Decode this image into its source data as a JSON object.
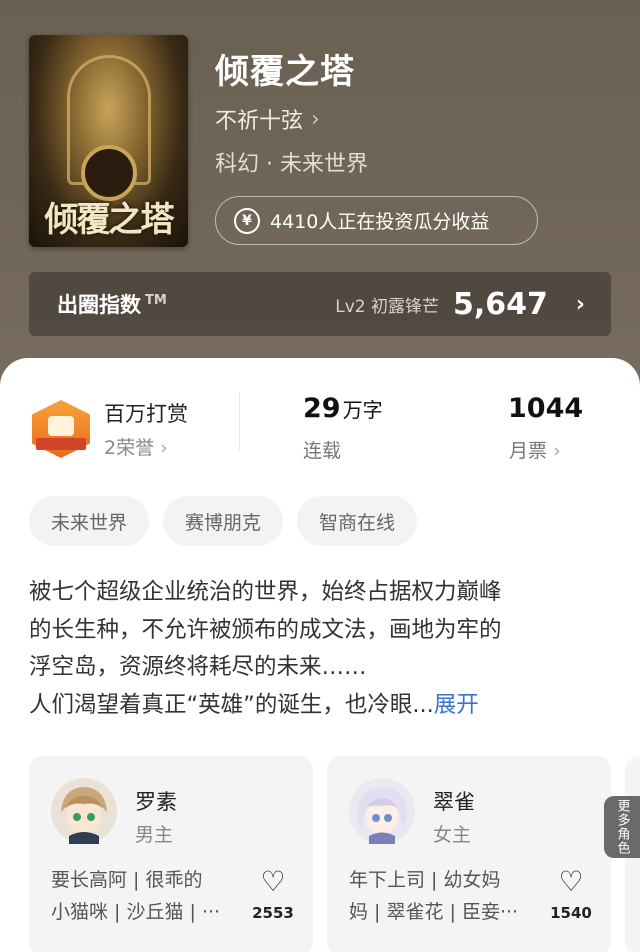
{
  "book": {
    "cover_title": "倾覆之塔",
    "title": "倾覆之塔",
    "author": "不祈十弦",
    "genre": "科幻 · 未来世界",
    "investors": "4410人正在投资瓜分收益"
  },
  "index": {
    "label": "出圈指数",
    "tm": "TM",
    "level": "Lv2 初露锋芒",
    "score": "5,647"
  },
  "stats": {
    "honor_title": "百万打赏",
    "honor_sub": "2荣誉",
    "words_num": "29",
    "words_unit": "万字",
    "words_label": "连载",
    "votes_num": "1044",
    "votes_label": "月票"
  },
  "tags": [
    "未来世界",
    "赛博朋克",
    "智商在线"
  ],
  "intro": {
    "lines": [
      "被七个超级企业统治的世界，始终占据权力巅峰",
      "的长生种，不允许被颁布的成文法，画地为牢的",
      "浮空岛，资源终将耗尽的未来……",
      "人们渴望着真正“英雄”的诞生，也冷眼..."
    ],
    "expand": "展开"
  },
  "characters": [
    {
      "name": "罗素",
      "role": "男主",
      "desc_lines": [
        "要长高阿 | 很乖的",
        "小猫咪 | 沙丘猫 | ···"
      ],
      "likes": "2553"
    },
    {
      "name": "翠雀",
      "role": "女主",
      "desc_lines": [
        "年下上司 | 幼女妈",
        "妈 | 翠雀花 | 臣妾···"
      ],
      "likes": "1540"
    }
  ],
  "more_roles": "更多角色",
  "colors": {
    "header_bg": "#6f6557",
    "accent_link": "#3f72c9",
    "badge_orange": "#f08a2c"
  }
}
